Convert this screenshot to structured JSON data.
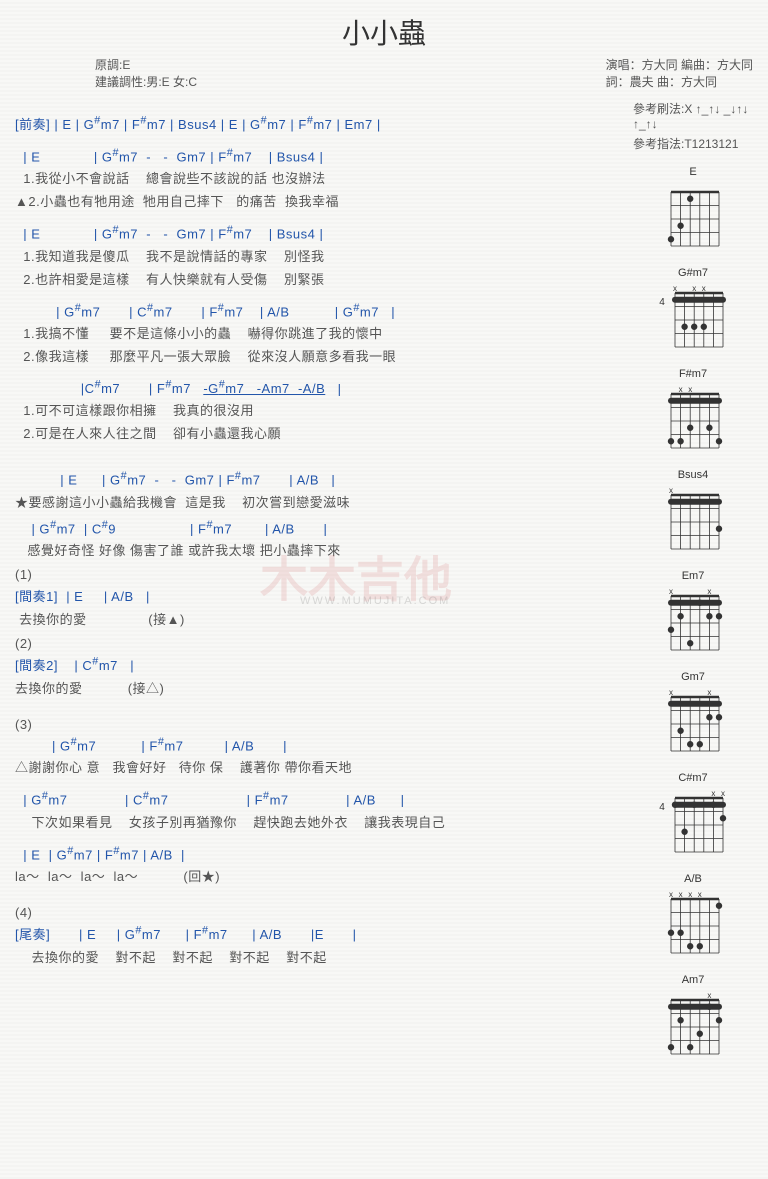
{
  "title": "小小蟲",
  "meta": {
    "left_line1": "原調:E",
    "left_line2": "建議調性:男:E 女:C",
    "right_line1": "演唱：方大同  編曲：方大同",
    "right_line2": "詞：農夫  曲：方大同"
  },
  "ref": {
    "strum": "參考刷法:X ↑_↑↓ _↓↑↓ ↑_↑↓",
    "finger": "參考指法:T1213121"
  },
  "intro_label": "[前奏]",
  "intro_chords": " | E | G#m7 | F#m7 | Bsus4 | E | G#m7 | F#m7 | Em7 |",
  "verseA": {
    "row1_chords": "  | E             | G#m7  -   -  Gm7 | F#m7    | Bsus4 |",
    "row1_l1": "  1.我從小不會說話    總會說些不該說的話 也沒辦法",
    "row1_l2": "▲2.小蟲也有牠用途  牠用自己摔下   的痛苦  換我幸福",
    "row2_chords": "  | E             | G#m7  -   -  Gm7 | F#m7    | Bsus4 |",
    "row2_l1": "  1.我知道我是傻瓜    我不是說情話的專家    別怪我",
    "row2_l2": "  2.也許相愛是這樣    有人快樂就有人受傷    別緊張",
    "row3_chords": "          | G#m7       | C#m7       | F#m7    | A/B           | G#m7   |",
    "row3_l1": "  1.我搞不懂     要不是這條小小的蟲    嚇得你跳進了我的懷中",
    "row3_l2": "  2.像我這樣     那麼平凡一張大眾臉    從來沒人願意多看我一眼",
    "row4_chords_a": "                |C#m7       | F#m7   ",
    "row4_chords_b": "-G#m7   -Am7  -A/B",
    "row4_chords_c": "   |",
    "row4_l1": "  1.可不可這樣跟你相擁    我真的很沒用",
    "row4_l2": "  2.可是在人來人往之間    卻有小蟲還我心願"
  },
  "chorus": {
    "row1_chords": "           | E      | G#m7  -   -  Gm7 | F#m7       | A/B   |",
    "row1_l": "★要感謝這小小蟲給我機會  這是我    初次嘗到戀愛滋味",
    "row2_chords": "    | G#m7  | C#9                  | F#m7        | A/B       |",
    "row2_l": "   感覺好奇怪 好像 傷害了誰 或許我太壞 把小蟲摔下來"
  },
  "bridge": {
    "num1": "(1)",
    "b1_label": "[間奏1]",
    "b1_chords": "  | E     | A/B   |",
    "b1_l": " 去換你的愛               (接▲)",
    "num2": "(2)",
    "b2_label": "[間奏2]",
    "b2_chords": "    | C#m7   |",
    "b2_l": "去換你的愛           (接△)",
    "num3": "(3)",
    "b3_row1_chords": "         | G#m7           | F#m7          | A/B       |",
    "b3_row1_l": "△謝謝你心 意   我會好好   待你 保    護著你 帶你看天地",
    "b3_row2_chords": "  | G#m7              | C#m7                   | F#m7              | A/B      |",
    "b3_row2_l": "    下次如果看見    女孩子別再猶豫你    趕快跑去她外衣    讓我表現自己",
    "b3_row3_chords": "  | E  | G#m7 | F#m7 | A/B  |",
    "b3_row3_l": "la～  la～  la～  la～           (回★)",
    "num4": "(4)"
  },
  "outro": {
    "label": "[尾奏]",
    "chords": "       | E     | G#m7      | F#m7      | A/B       |E       |",
    "l": "    去換你的愛    對不起    對不起    對不起    對不起"
  },
  "diagrams": [
    "E",
    "G#m7",
    "F#m7",
    "Bsus4",
    "Em7",
    "Gm7",
    "C#m7",
    "A/B",
    "Am7"
  ],
  "diag_fret": {
    "G#m7": "4",
    "C#m7": "4"
  }
}
